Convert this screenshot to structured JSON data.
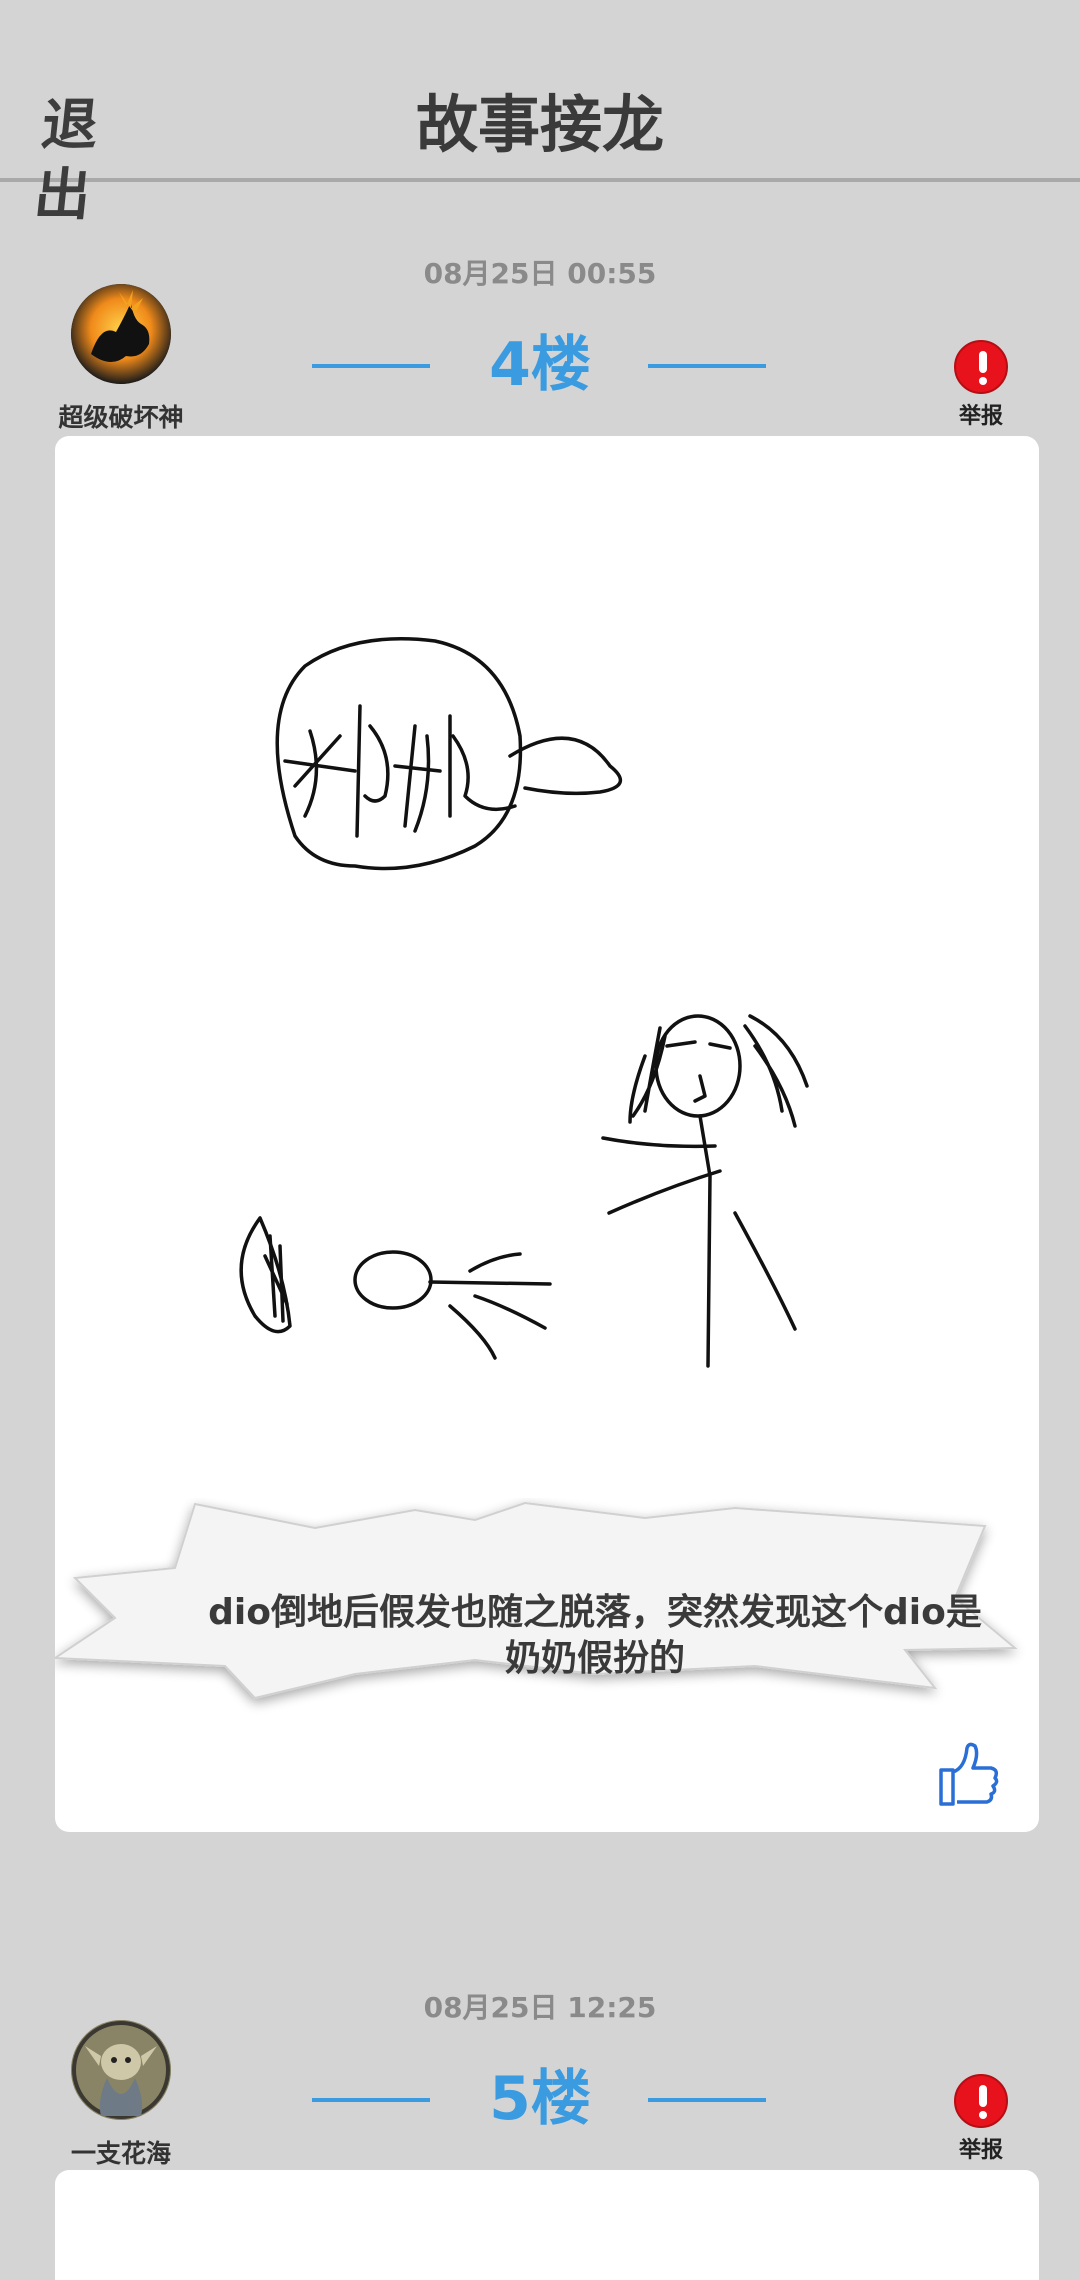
{
  "header": {
    "exit_label": "退出",
    "title": "故事接龙"
  },
  "posts": [
    {
      "timestamp": "08月25日  00:55",
      "floor": "4楼",
      "username": "超级破坏神",
      "avatar_icon": "dragon-avatar-icon",
      "report_label": "举报",
      "drawing_text": "奶奶",
      "caption": "dio倒地后假发也随之脱落，突然发现这个dio是奶奶假扮的",
      "like_icon": "thumbs-up-icon"
    },
    {
      "timestamp": "08月25日  12:25",
      "floor": "5楼",
      "username": "一支花海",
      "avatar_icon": "creature-avatar-icon",
      "report_label": "举报"
    }
  ],
  "colors": {
    "accent": "#3a9be0",
    "report": "#e8121c",
    "background": "#d4d4d4"
  }
}
